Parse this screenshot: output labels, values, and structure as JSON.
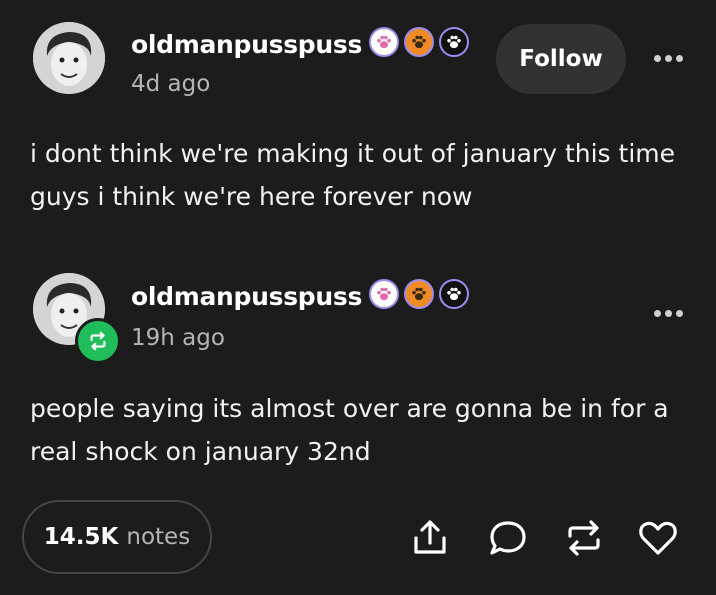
{
  "post": {
    "username": "oldmanpusspuss",
    "timestamp": "4d ago",
    "follow_label": "Follow",
    "text": "i dont think we're making it out of january this time guys i think we're here forever now"
  },
  "reblog": {
    "username": "oldmanpusspuss",
    "timestamp": "19h ago",
    "text": "people saying its almost over are gonna be in for a real shock on january 32nd"
  },
  "footer": {
    "notes_count": "14.5K",
    "notes_label": "notes"
  },
  "badges": [
    {
      "name": "paw-badge-pink",
      "fill": "#ffffff",
      "paw": "#e06aa8"
    },
    {
      "name": "paw-badge-orange",
      "fill": "#f08a24",
      "paw": "#3a2a10"
    },
    {
      "name": "paw-badge-black",
      "fill": "#111111",
      "paw": "#ffffff"
    }
  ],
  "colors": {
    "background": "#1c1c1c",
    "reblog_green": "#1fbe5a",
    "badge_border": "#9b8cf0"
  }
}
